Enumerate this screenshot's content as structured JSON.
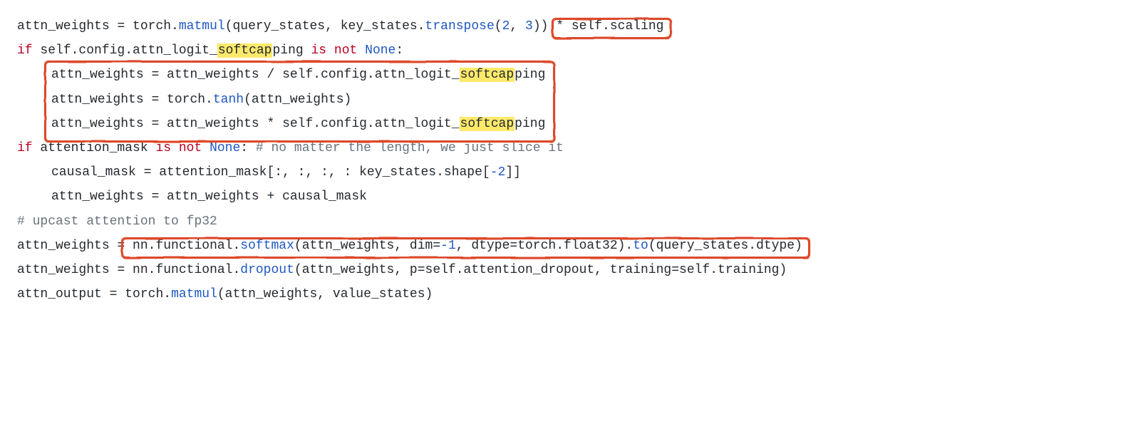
{
  "code": {
    "l1": {
      "a": "attn_weights ",
      "eq": "=",
      "b": " torch.",
      "matmul": "matmul",
      "c": "(query_states, key_states.",
      "transpose": "transpose",
      "d": "(",
      "n2": "2",
      "comma": ", ",
      "n3": "3",
      "e": ")) ",
      "star": "*",
      "f": " self.scaling"
    },
    "l3": {
      "if": "if",
      "a": " self.config.attn_logit_",
      "softcap": "softcap",
      "b": "ping ",
      "is": "is",
      "sp": " ",
      "not": "not",
      "sp2": " ",
      "none": "None",
      "colon": ":"
    },
    "l4": {
      "a": "attn_weights ",
      "eq": "=",
      "b": " attn_weights ",
      "div": "/",
      "c": " self.config.attn_logit_",
      "softcap": "softcap",
      "d": "ping"
    },
    "l5": {
      "a": "attn_weights ",
      "eq": "=",
      "b": " torch.",
      "tanh": "tanh",
      "c": "(attn_weights)"
    },
    "l6": {
      "a": "attn_weights ",
      "eq": "=",
      "b": " attn_weights ",
      "star": "*",
      "c": " self.config.attn_logit_",
      "softcap": "softcap",
      "d": "ping"
    },
    "l7": {
      "if": "if",
      "a": " attention_mask ",
      "is": "is",
      "sp": " ",
      "not": "not",
      "sp2": " ",
      "none": "None",
      "colon": ":  ",
      "comment": "# no matter the length, we just slice it"
    },
    "l8": {
      "a": "causal_mask ",
      "eq": "=",
      "b": " attention_mask[:, :, :, : key_states.shape[",
      "neg2": "-2",
      "c": "]]"
    },
    "l9": {
      "a": "attn_weights ",
      "eq": "=",
      "b": " attn_weights ",
      "plus": "+",
      "c": " causal_mask"
    },
    "l11": {
      "comment": "# upcast attention to fp32"
    },
    "l12": {
      "a": "attn_weights ",
      "eq": "=",
      "b": " nn.functional.",
      "softmax": "softmax",
      "c": "(attn_weights, dim",
      "eq2": "=",
      "neg1": "-1",
      "d": ", dtype",
      "eq3": "=",
      "e": "torch.float32).",
      "to": "to",
      "f": "(query_states.dtype)"
    },
    "l13": {
      "a": "attn_weights ",
      "eq": "=",
      "b": " nn.functional.",
      "dropout": "dropout",
      "c": "(attn_weights, p",
      "eq2": "=",
      "d": "self.attention_dropout, training",
      "eq3": "=",
      "e": "self.training)"
    },
    "l14": {
      "a": "attn_output ",
      "eq": "=",
      "b": " torch.",
      "matmul": "matmul",
      "c": "(attn_weights, value_states)"
    }
  }
}
